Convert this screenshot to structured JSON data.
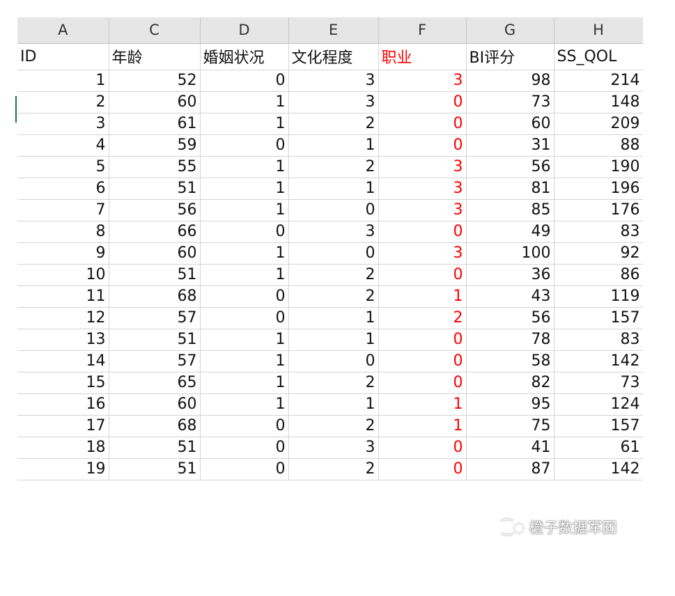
{
  "columns": [
    "A",
    "C",
    "D",
    "E",
    "F",
    "G",
    "H"
  ],
  "headers": [
    "ID",
    "年龄",
    "婚姻状况",
    "文化程度",
    "职业",
    "BI评分",
    "SS_QOL"
  ],
  "rows": [
    [
      "1",
      "52",
      "0",
      "3",
      "3",
      "98",
      "214"
    ],
    [
      "2",
      "60",
      "1",
      "3",
      "0",
      "73",
      "148"
    ],
    [
      "3",
      "61",
      "1",
      "2",
      "0",
      "60",
      "209"
    ],
    [
      "4",
      "59",
      "0",
      "1",
      "0",
      "31",
      "88"
    ],
    [
      "5",
      "55",
      "1",
      "2",
      "3",
      "56",
      "190"
    ],
    [
      "6",
      "51",
      "1",
      "1",
      "3",
      "81",
      "196"
    ],
    [
      "7",
      "56",
      "1",
      "0",
      "3",
      "85",
      "176"
    ],
    [
      "8",
      "66",
      "0",
      "3",
      "0",
      "49",
      "83"
    ],
    [
      "9",
      "60",
      "1",
      "0",
      "3",
      "100",
      "92"
    ],
    [
      "10",
      "51",
      "1",
      "2",
      "0",
      "36",
      "86"
    ],
    [
      "11",
      "68",
      "0",
      "2",
      "1",
      "43",
      "119"
    ],
    [
      "12",
      "57",
      "0",
      "1",
      "2",
      "56",
      "157"
    ],
    [
      "13",
      "51",
      "1",
      "1",
      "0",
      "78",
      "83"
    ],
    [
      "14",
      "57",
      "1",
      "0",
      "0",
      "58",
      "142"
    ],
    [
      "15",
      "65",
      "1",
      "2",
      "0",
      "82",
      "73"
    ],
    [
      "16",
      "60",
      "1",
      "1",
      "1",
      "95",
      "124"
    ],
    [
      "17",
      "68",
      "0",
      "2",
      "1",
      "75",
      "157"
    ],
    [
      "18",
      "51",
      "0",
      "3",
      "0",
      "41",
      "61"
    ],
    [
      "19",
      "51",
      "0",
      "2",
      "0",
      "87",
      "142"
    ]
  ],
  "highlight_color": "#ff0000",
  "watermark": {
    "icon": "wechat-icon",
    "text": "橙子数据军团"
  }
}
